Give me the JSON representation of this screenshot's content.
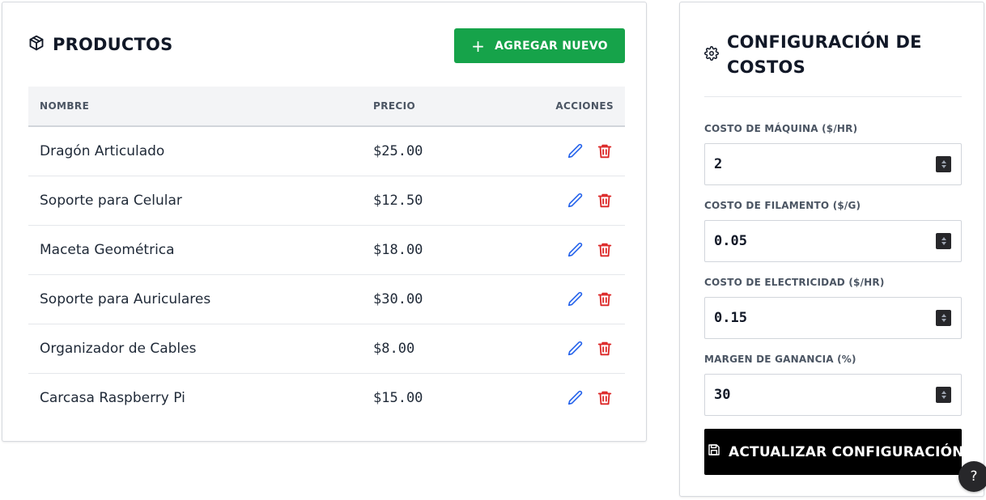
{
  "products": {
    "title": "PRODUCTOS",
    "icon": "box-icon",
    "add_button_label": "AGREGAR NUEVO",
    "columns": {
      "name": "NOMBRE",
      "price": "PRECIO",
      "actions": "ACCIONES"
    },
    "rows": [
      {
        "name": "Dragón Articulado",
        "price": "$25.00"
      },
      {
        "name": "Soporte para Celular",
        "price": "$12.50"
      },
      {
        "name": "Maceta Geométrica",
        "price": "$18.00"
      },
      {
        "name": "Soporte para Auriculares",
        "price": "$30.00"
      },
      {
        "name": "Organizador de Cables",
        "price": "$8.00"
      },
      {
        "name": "Carcasa Raspberry Pi",
        "price": "$15.00"
      }
    ]
  },
  "config": {
    "title": "CONFIGURACIÓN DE COSTOS",
    "icon": "gear-icon",
    "fields": [
      {
        "label": "COSTO DE MÁQUINA ($/HR)",
        "value": "2"
      },
      {
        "label": "COSTO DE FILAMENTO ($/G)",
        "value": "0.05"
      },
      {
        "label": "COSTO DE ELECTRICIDAD ($/HR)",
        "value": "0.15"
      },
      {
        "label": "MARGEN DE GANANCIA (%)",
        "value": "30"
      }
    ],
    "update_button_label": "ACTUALIZAR CONFIGURACIÓN"
  },
  "help": {
    "label": "?"
  },
  "colors": {
    "primary_green": "#16a34a",
    "edit_blue": "#2563eb",
    "delete_red": "#dc2626",
    "button_black": "#000000"
  }
}
